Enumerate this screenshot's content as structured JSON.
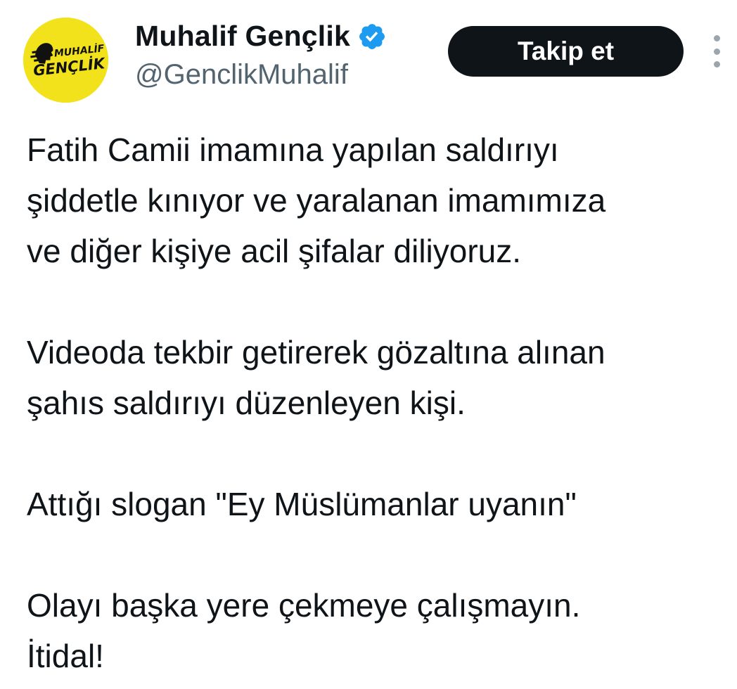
{
  "account": {
    "display_name": "Muhalif Gençlik",
    "handle": "@GenclikMuhalif",
    "verified": true,
    "avatar_text_line1": "MUHALİF",
    "avatar_text_line2": "GENÇLİK",
    "avatar_color": "#f2e21b"
  },
  "actions": {
    "follow_label": "Takip et",
    "more_icon": "more-vertical-icon"
  },
  "tweet": {
    "paragraphs": [
      [
        "Fatih Camii imamına yapılan saldırıyı",
        "şiddetle kınıyor ve yaralanan imamımıza",
        "ve diğer kişiye acil şifalar diliyoruz."
      ],
      [
        "Videoda tekbir getirerek gözaltına alınan",
        "şahıs saldırıyı düzenleyen kişi."
      ],
      [
        "Attığı slogan \"Ey Müslümanlar uyanın\""
      ],
      [
        "Olayı başka yere çekmeye çalışmayın.",
        "İtidal!"
      ]
    ]
  },
  "colors": {
    "verified_badge": "#1d9bf0",
    "follow_button_bg": "#0f1419",
    "secondary_text": "#536471"
  }
}
